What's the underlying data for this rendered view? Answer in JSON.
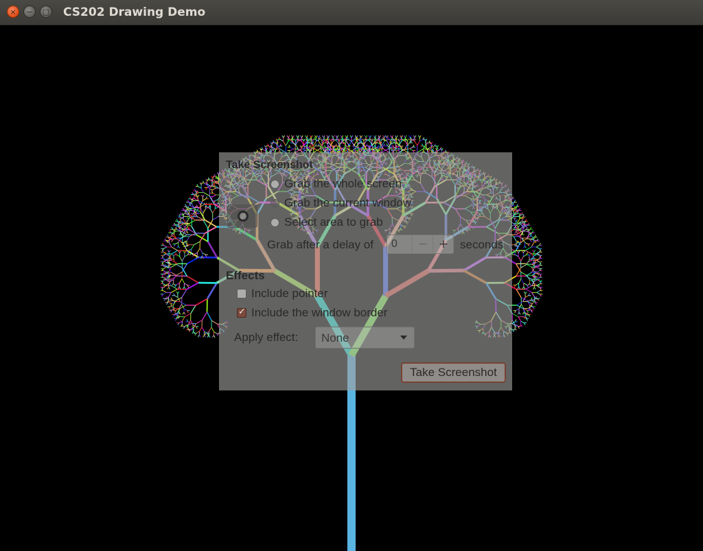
{
  "window": {
    "title": "CS202 Drawing Demo",
    "close_icon": "×",
    "minimize_icon": "−",
    "maximize_icon": "□"
  },
  "drawing": {
    "description_type": "recursive-fractal-tree",
    "trunk_color": "#5ab4e2",
    "background_color": "#000000"
  },
  "dialog": {
    "title": "Take Screenshot",
    "options": [
      {
        "label": "Grab the whole screen",
        "selected": false
      },
      {
        "label": "Grab the current window",
        "selected": true
      },
      {
        "label": "Select area to grab",
        "selected": false
      }
    ],
    "delay_label": "Grab after a delay of",
    "delay_value": "0",
    "delay_minus": "−",
    "delay_plus": "+",
    "delay_unit": "seconds",
    "effects_heading": "Effects",
    "include_pointer_label": "Include pointer",
    "include_pointer_checked": false,
    "include_border_label": "Include the window border",
    "include_border_checked": true,
    "apply_effect_label": "Apply effect:",
    "apply_effect_value": "None",
    "take_button": "Take Screenshot"
  }
}
